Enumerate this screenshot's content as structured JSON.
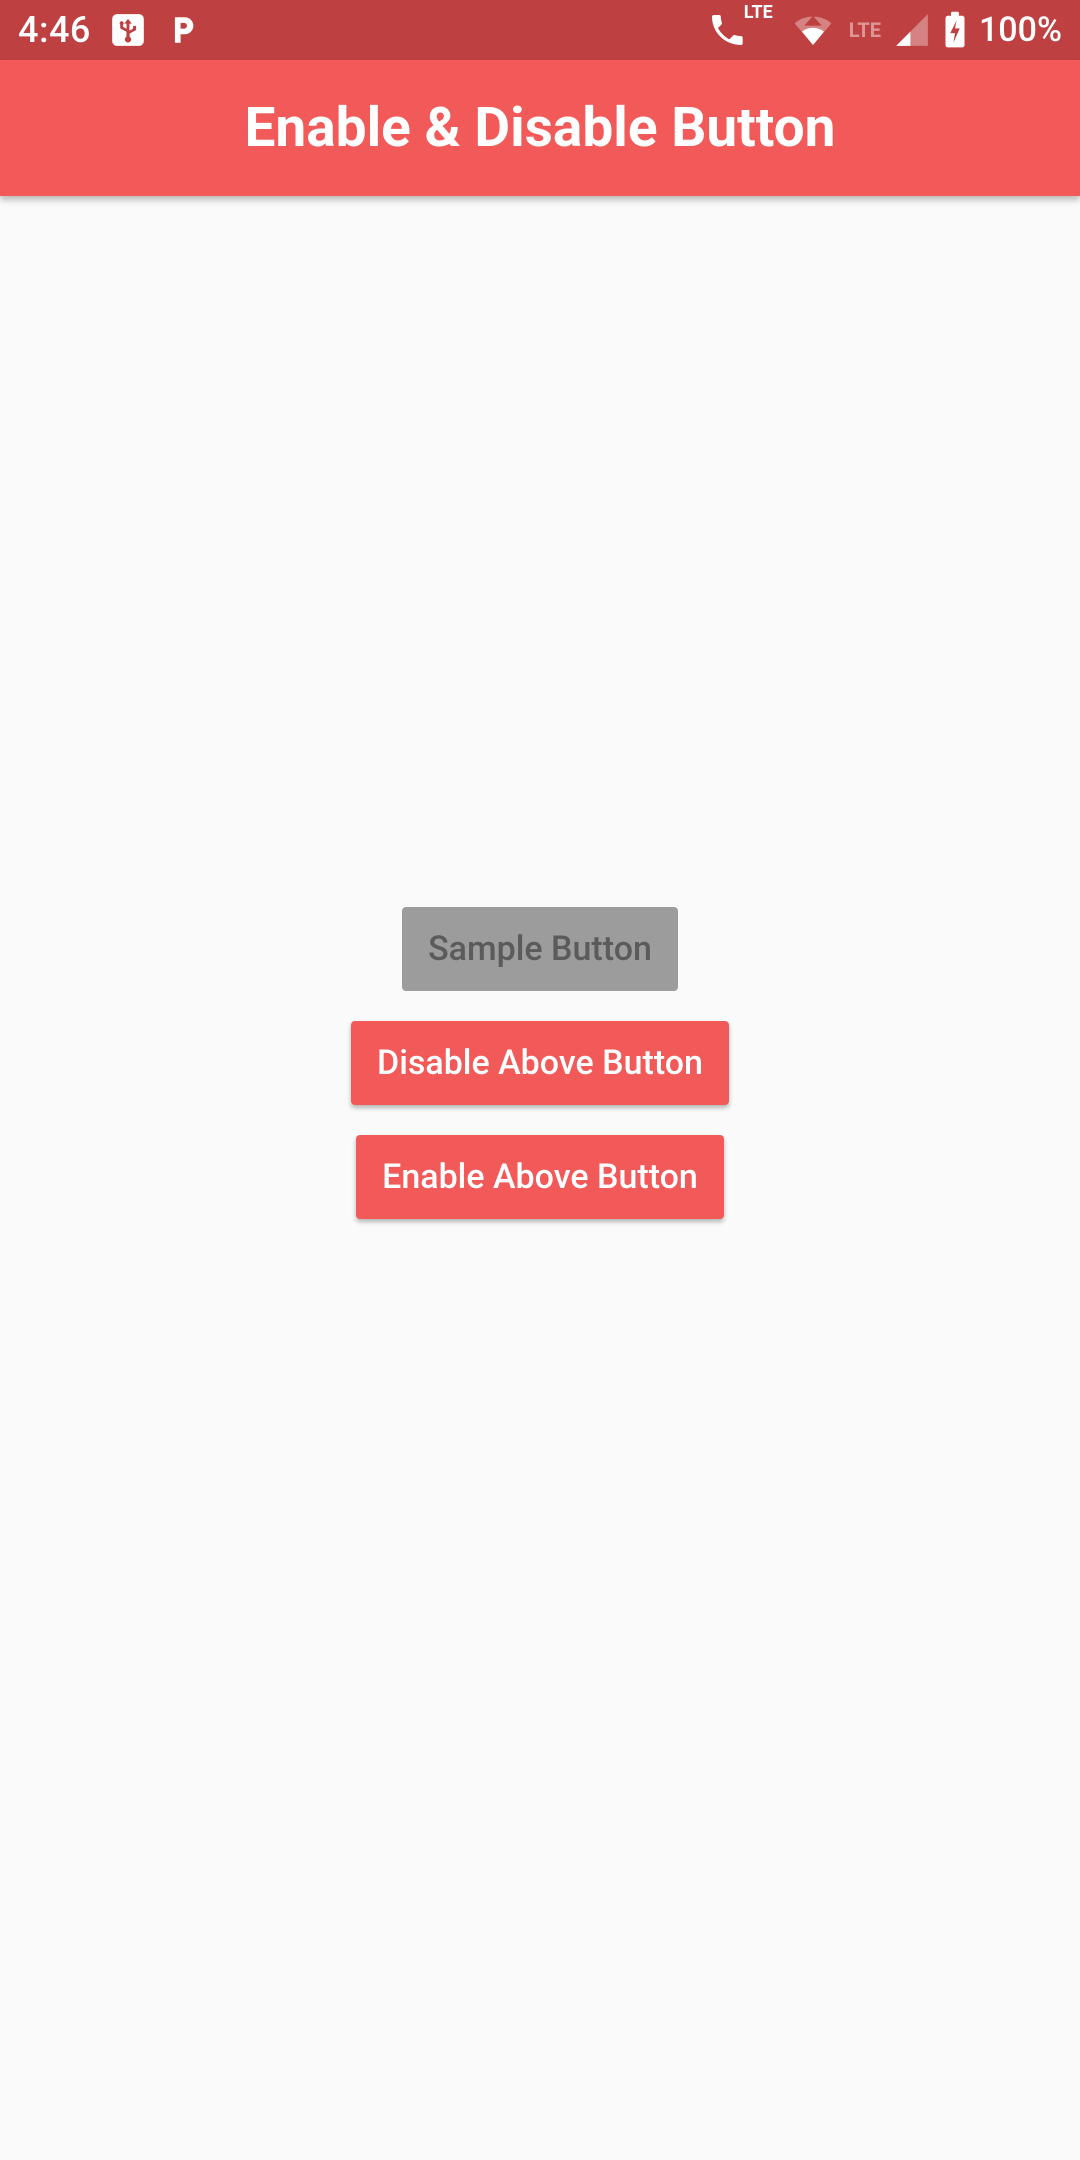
{
  "status": {
    "time": "4:46",
    "lte_label": "LTE",
    "battery": "100%"
  },
  "appbar": {
    "title": "Enable & Disable Button"
  },
  "buttons": {
    "sample": "Sample Button",
    "disable": "Disable Above Button",
    "enable": "Enable Above Button"
  },
  "colors": {
    "status_bar": "#bf4040",
    "app_bar": "#F15A59",
    "accent": "#F15A59",
    "disabled_bg": "#9c9c9c",
    "disabled_text": "#5b5b5b",
    "page_bg": "#fafafa"
  }
}
